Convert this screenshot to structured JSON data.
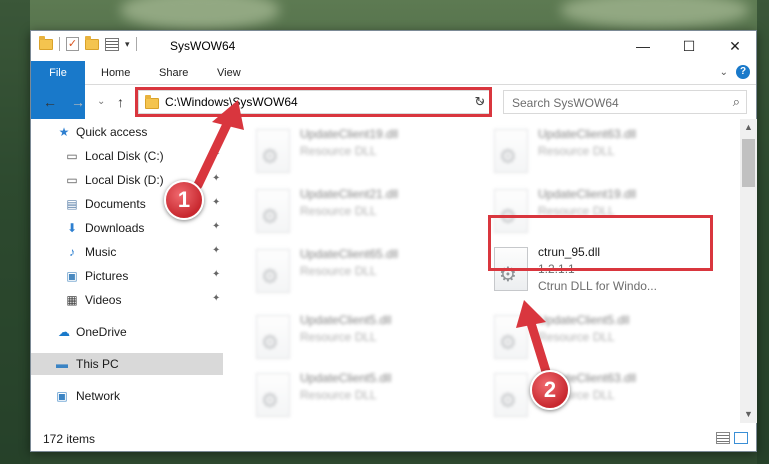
{
  "window": {
    "title": "SysWOW64",
    "minimize": "—",
    "maximize": "☐",
    "close": "✕"
  },
  "ribbon": {
    "tabs": [
      "File",
      "Home",
      "Share",
      "View"
    ],
    "expand": "⌄",
    "help": "?"
  },
  "navigation": {
    "back": "←",
    "forward": "→",
    "recent": "⌄",
    "up": "↑",
    "address": "C:\\Windows\\SysWOW64",
    "address_dropdown": "⌄",
    "refresh": "↻",
    "search_placeholder": "Search SysWOW64",
    "search_icon": "⌕"
  },
  "sidebar": {
    "items": [
      {
        "label": "Quick access",
        "icon": "star-icon",
        "glyph": "★",
        "color": "#2d7fd0"
      },
      {
        "label": "Local Disk (C:)",
        "icon": "drive-icon",
        "glyph": "▭",
        "color": "#555555",
        "pinned": true
      },
      {
        "label": "Local Disk (D:)",
        "icon": "drive-icon",
        "glyph": "▭",
        "color": "#555555",
        "pinned": true
      },
      {
        "label": "Documents",
        "icon": "documents-icon",
        "glyph": "▤",
        "color": "#5a7fa8",
        "pinned": true
      },
      {
        "label": "Downloads",
        "icon": "downloads-icon",
        "glyph": "⬇",
        "color": "#2d7fd0",
        "pinned": true
      },
      {
        "label": "Music",
        "icon": "music-icon",
        "glyph": "♪",
        "color": "#2d7fd0",
        "pinned": true
      },
      {
        "label": "Pictures",
        "icon": "pictures-icon",
        "glyph": "▣",
        "color": "#4a8ac0",
        "pinned": true
      },
      {
        "label": "Videos",
        "icon": "videos-icon",
        "glyph": "▦",
        "color": "#444444",
        "pinned": true
      },
      {
        "label": "OneDrive",
        "icon": "onedrive-icon",
        "glyph": "☁",
        "color": "#1979ca"
      },
      {
        "label": "This PC",
        "icon": "this-pc-icon",
        "glyph": "▬",
        "color": "#3b84c4",
        "selected": true
      },
      {
        "label": "Network",
        "icon": "network-icon",
        "glyph": "▣",
        "color": "#3b84c4"
      }
    ],
    "pin_glyph": "📌"
  },
  "files": [
    {
      "name": "UpdateClient19.dll",
      "type": "Resource DLL",
      "blurred": true
    },
    {
      "name": "UpdateClient63.dll",
      "type": "Resource DLL",
      "blurred": true
    },
    {
      "name": "UpdateClient21.dll",
      "type": "Resource DLL",
      "blurred": true
    },
    {
      "name": "UpdateClient19.dll",
      "type": "Resource DLL",
      "blurred": true
    },
    {
      "name": "UpdateClient65.dll",
      "type": "Resource DLL",
      "blurred": true
    },
    {
      "name": "ctrun_95.dll",
      "version": "1.2.1.1",
      "type": "Ctrun DLL for Windo...",
      "blurred": false
    },
    {
      "name": "UpdateClient5.dll",
      "type": "Resource DLL",
      "blurred": true
    },
    {
      "name": "UpdateClient5.dll",
      "type": "Resource DLL",
      "blurred": true
    },
    {
      "name": "UpdateClient5.dll",
      "type": "Resource DLL",
      "blurred": true
    },
    {
      "name": "UpdateClient63.dll",
      "type": "Resource DLL",
      "blurred": true
    }
  ],
  "status": {
    "item_count": "172 items"
  },
  "annotations": {
    "step1": "1",
    "step2": "2",
    "color": "#d9363e"
  }
}
